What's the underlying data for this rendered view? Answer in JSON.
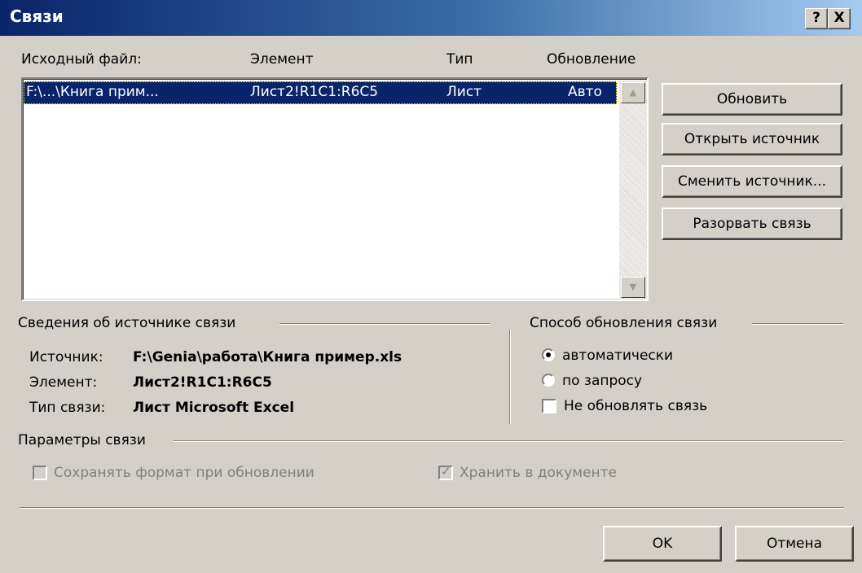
{
  "window": {
    "title": "Связи",
    "help_glyph": "?",
    "close_glyph": "X"
  },
  "list": {
    "columns": [
      "Исходный файл:",
      "Элемент",
      "Тип",
      "Обновление"
    ],
    "rows": [
      {
        "file": "F:\\...\\Книга прим...",
        "element": "Лист2!R1C1:R6C5",
        "type": "Лист",
        "update": "Авто"
      }
    ]
  },
  "buttons": {
    "update": "Обновить",
    "open_source": "Открыть источник",
    "change_source": "Сменить источник...",
    "break_link": "Разорвать связь",
    "ok": "OK",
    "cancel": "Отмена"
  },
  "source_info": {
    "heading": "Сведения об источнике связи",
    "source_label": "Источник:",
    "source_value": "F:\\Genia\\работа\\Книга пример.xls",
    "element_label": "Элемент:",
    "element_value": "Лист2!R1C1:R6C5",
    "type_label": "Тип связи:",
    "type_value": "Лист Microsoft Excel"
  },
  "update_method": {
    "heading": "Способ обновления связи",
    "auto": "автоматически",
    "manual": "по запросу",
    "locked": "Не обновлять связь",
    "selected": "auto"
  },
  "link_params": {
    "heading": "Параметры связи",
    "preserve_format": "Сохранять формат при обновлении",
    "store_in_doc": "Хранить в документе"
  }
}
